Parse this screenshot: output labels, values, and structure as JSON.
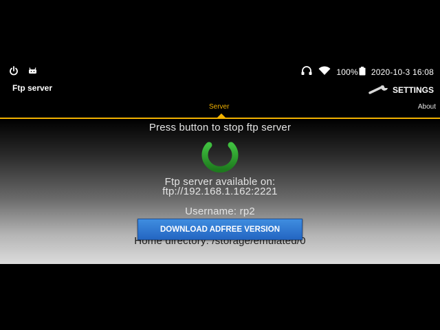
{
  "status_bar": {
    "left_icons": [
      "power-icon",
      "android-icon"
    ],
    "right_icons": [
      "headset-icon",
      "wifi-icon",
      "battery-icon"
    ],
    "battery": "100%",
    "datetime": "2020-10-3 16:08"
  },
  "app_bar": {
    "title": "Ftp server",
    "settings_label": "SETTINGS",
    "settings_icon": "wrench-icon"
  },
  "tabs": [
    {
      "label": "Server",
      "active": true
    },
    {
      "label": "About",
      "active": false
    }
  ],
  "colors": {
    "accent": "#f2b200",
    "power_green": "#2e9b2e",
    "button_blue": "#2b74cf"
  },
  "main": {
    "instruction": "Press button to stop ftp server",
    "power_icon": "power-icon",
    "available_label": "Ftp server available on:",
    "address": "ftp://192.168.1.162:2221",
    "username": "Username: rp2",
    "download_button": "DOWNLOAD ADFREE VERSION",
    "home_directory": "Home directory: /storage/emulated/0"
  }
}
